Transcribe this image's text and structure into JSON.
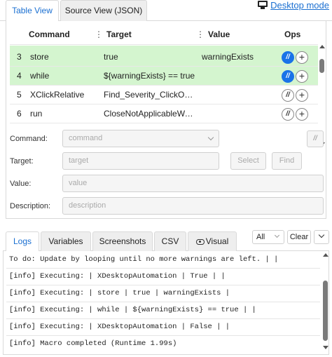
{
  "top_tabs": {
    "table_view": "Table View",
    "source_view": "Source View (JSON)"
  },
  "desktop_mode": {
    "label": "Desktop mode",
    "icon": "monitor-icon"
  },
  "table": {
    "headers": {
      "command": "Command",
      "target": "Target",
      "value": "Value",
      "ops": "Ops"
    },
    "rows": [
      {
        "num": "3",
        "command": "store",
        "target": "true",
        "value": "warningExists",
        "highlighted": true,
        "comment_active": true
      },
      {
        "num": "4",
        "command": "while",
        "target": "${warningExists} == true",
        "value": "",
        "highlighted": true,
        "comment_active": true
      },
      {
        "num": "5",
        "command": "XClickRelative",
        "target": "Find_Severity_ClickOnWar...",
        "value": "",
        "highlighted": false,
        "comment_active": false
      },
      {
        "num": "6",
        "command": "run",
        "target": "CloseNotApplicableWarni...",
        "value": "",
        "highlighted": false,
        "comment_active": false
      }
    ],
    "op_comment": "//",
    "op_add": "+"
  },
  "form": {
    "command_label": "Command:",
    "command_placeholder": "command",
    "comment_btn": "//",
    "target_label": "Target:",
    "target_placeholder": "target",
    "select_label": "Select",
    "find_label": "Find",
    "value_label": "Value:",
    "value_placeholder": "value",
    "description_label": "Description:",
    "description_placeholder": "description"
  },
  "bottom_tabs": {
    "logs": "Logs",
    "variables": "Variables",
    "screenshots": "Screenshots",
    "csv": "CSV",
    "visual": "Visual"
  },
  "log_controls": {
    "filter": "All",
    "clear": "Clear"
  },
  "logs": [
    "To do: Update by looping until no more warnings are left. |  |",
    "[info] Executing:  | XDesktopAutomation | True |  |",
    "[info] Executing:  | store | true | warningExists |",
    "[info] Executing:  | while | ${warningExists} == true |  |",
    "[info] Executing:  | XDesktopAutomation | False |  |",
    "[info] Macro completed (Runtime 1.99s)"
  ],
  "colors": {
    "accent": "#1a6fd1",
    "row_highlight": "#d4f5cf",
    "comment_active": "#1a73e8"
  }
}
